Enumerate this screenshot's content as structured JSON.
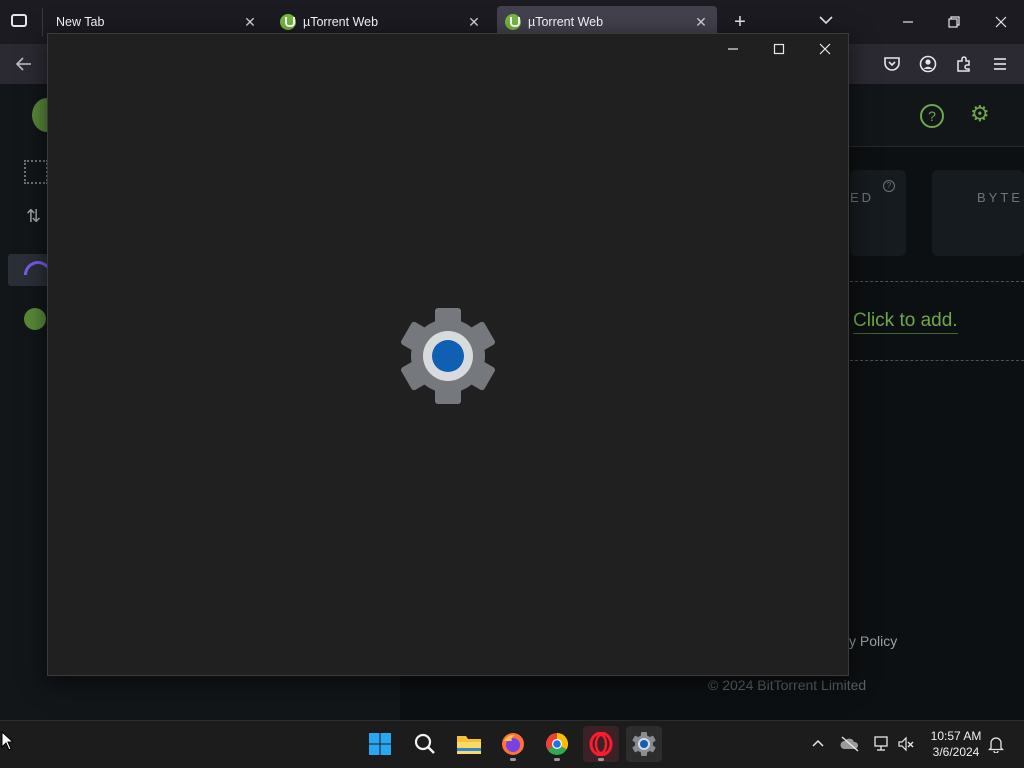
{
  "browser": {
    "tabs": [
      {
        "title": "New Tab",
        "active": false,
        "favicon": "none"
      },
      {
        "title": "µTorrent Web",
        "active": false,
        "favicon": "utorrent-icon"
      },
      {
        "title": "µTorrent Web",
        "active": true,
        "favicon": "utorrent-icon"
      }
    ],
    "new_tab_label": "+",
    "close_label": "✕"
  },
  "utorrent": {
    "stat_labels": [
      "ED",
      "BYTES"
    ],
    "click_to_add": "Click to add.",
    "privacy_policy": "cy Policy",
    "copyright": "© 2024 BitTorrent Limited"
  },
  "settings_window": {
    "icon": "gear-icon",
    "colors": {
      "gear": "#75787d",
      "ring": "#d8dadc",
      "center": "#0f5fb5"
    }
  },
  "taskbar": {
    "apps": [
      "start-icon",
      "search-icon",
      "file-explorer-icon",
      "firefox-icon",
      "chrome-icon",
      "opera-icon",
      "settings-icon"
    ],
    "clock": {
      "time": "10:57 AM",
      "date": "3/6/2024"
    }
  }
}
